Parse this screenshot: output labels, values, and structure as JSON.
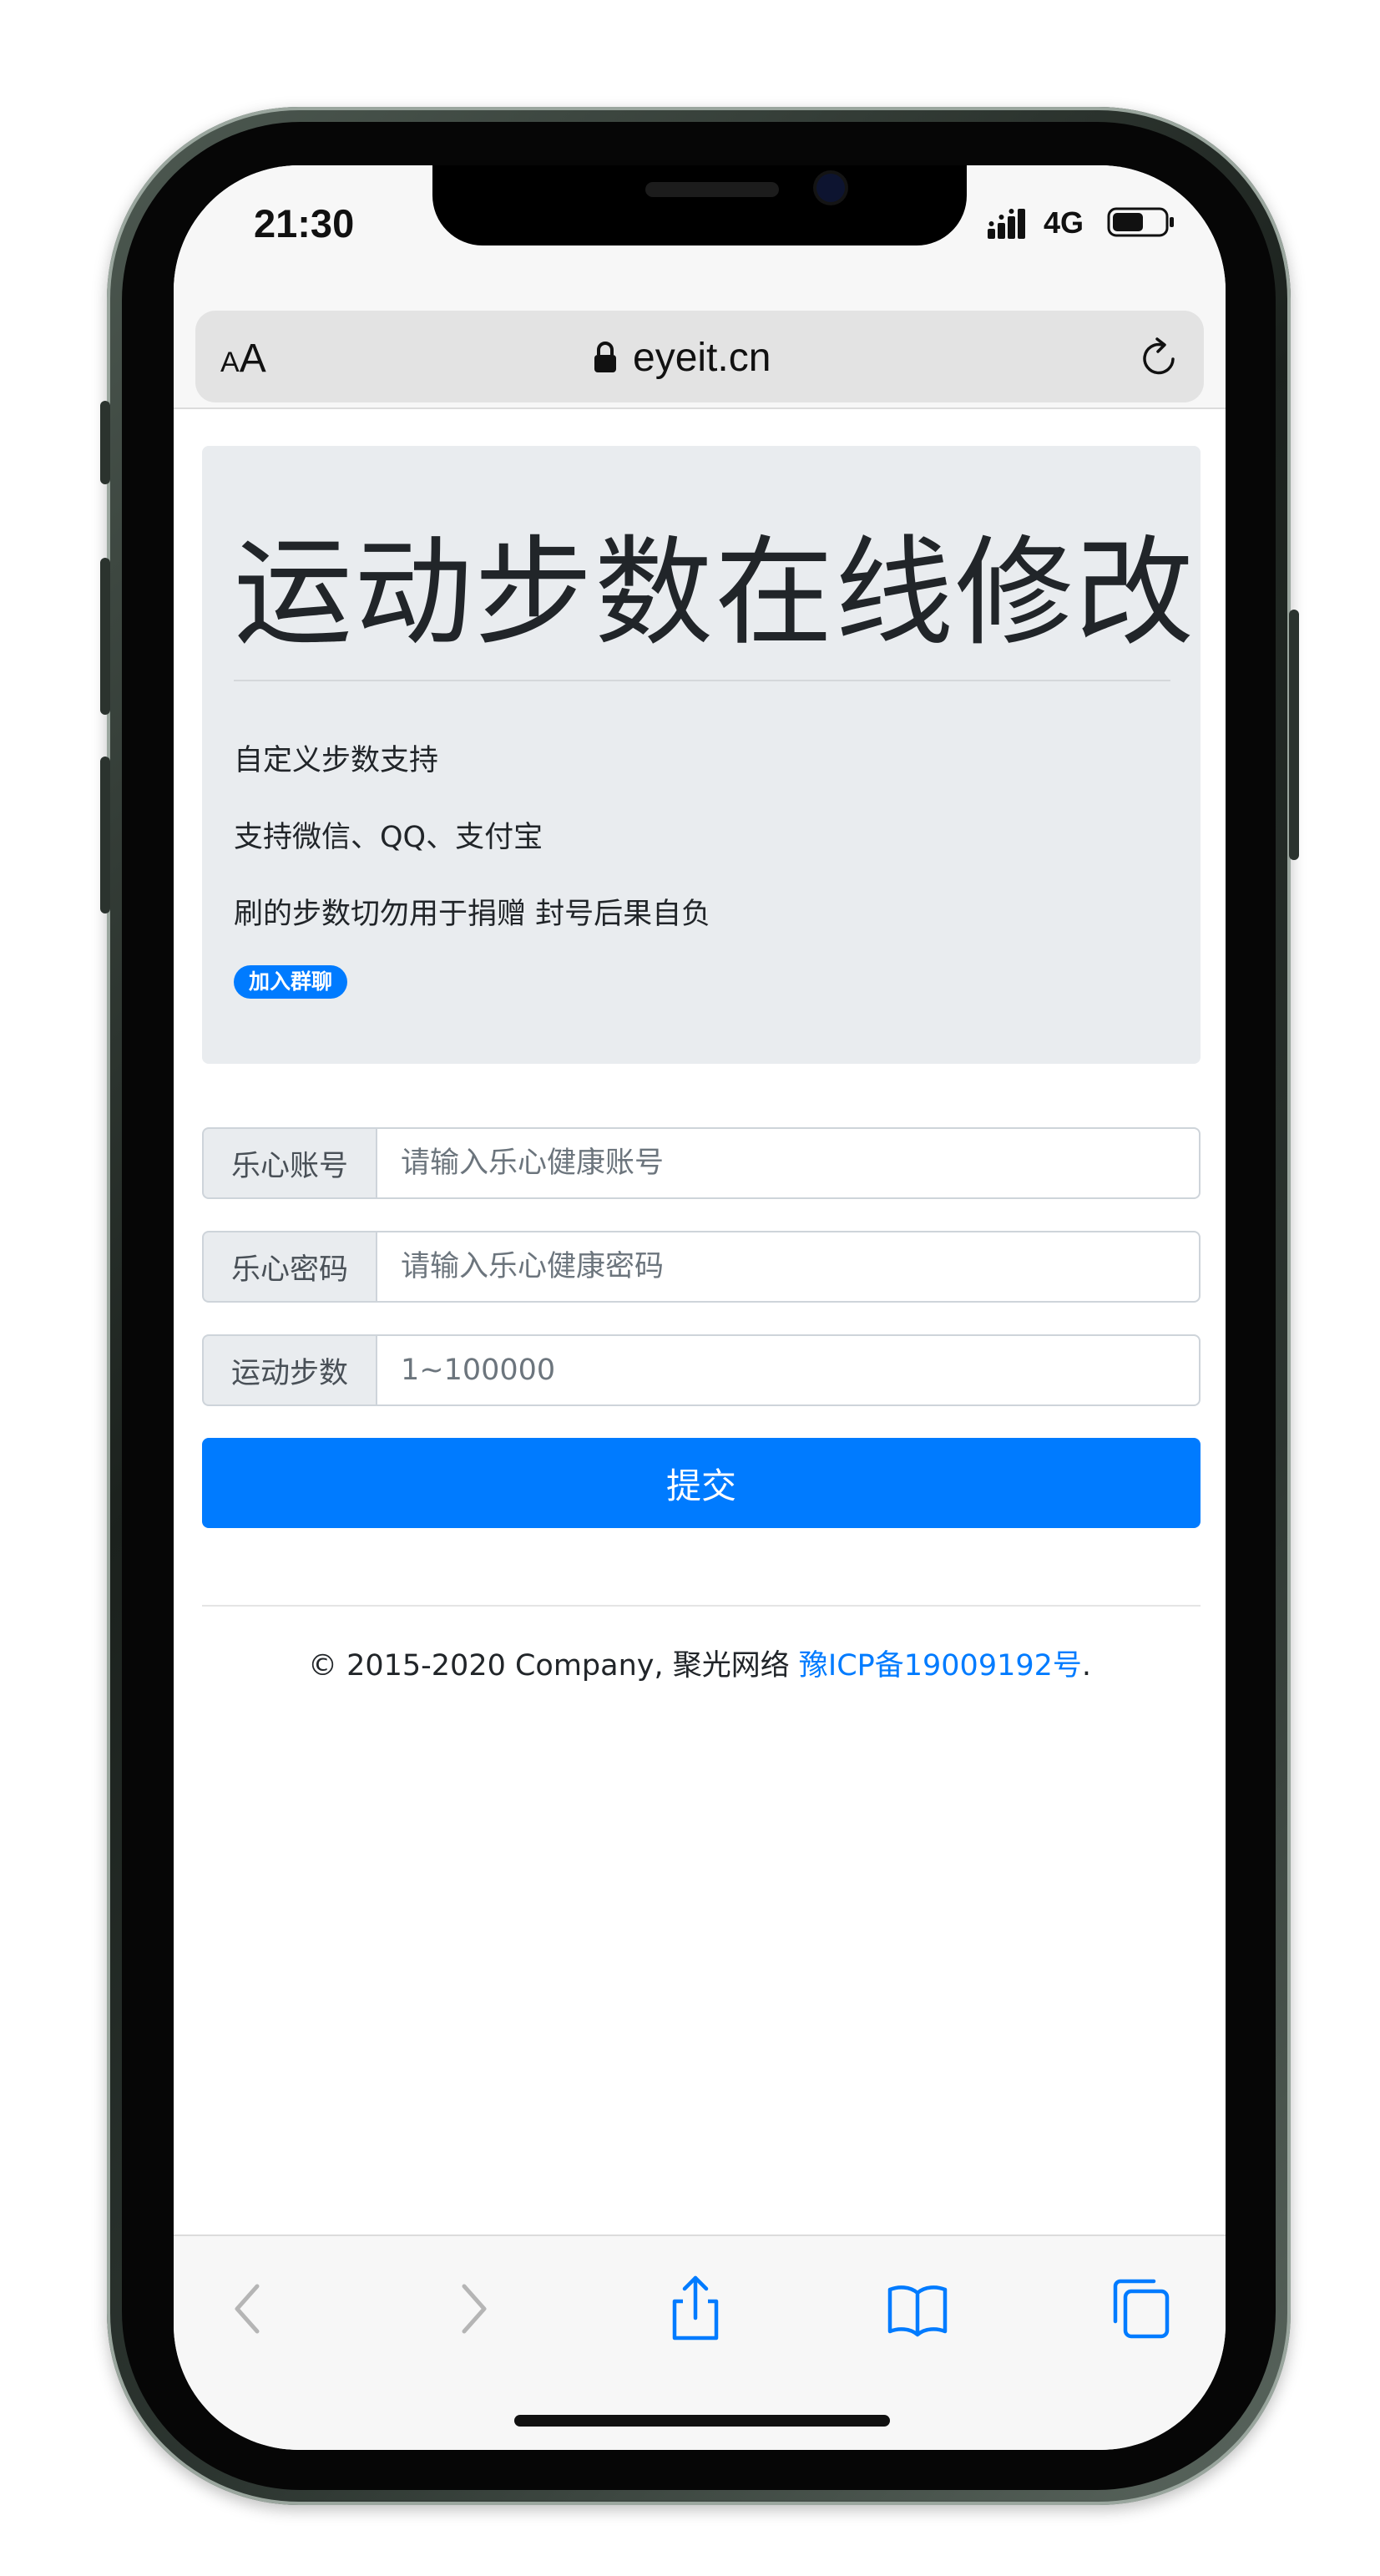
{
  "status_bar": {
    "time": "21:30",
    "network": "4G",
    "icons": [
      "signal-icon",
      "battery-icon"
    ]
  },
  "browser": {
    "text_size_small": "A",
    "text_size_large": "A",
    "url": "eyeit.cn",
    "icons": [
      "lock-icon",
      "reload-icon"
    ]
  },
  "hero": {
    "title": "运动步数在线修改",
    "features": [
      "自定义步数支持",
      "支持微信、QQ、支付宝",
      "刷的步数切勿用于捐赠 封号后果自负"
    ],
    "join_badge": "加入群聊"
  },
  "form": {
    "account": {
      "label": "乐心账号",
      "placeholder": "请输入乐心健康账号",
      "value": ""
    },
    "password": {
      "label": "乐心密码",
      "placeholder": "请输入乐心健康密码",
      "value": ""
    },
    "steps": {
      "label": "运动步数",
      "placeholder": "1~100000",
      "value": ""
    },
    "submit_label": "提交"
  },
  "footer": {
    "copyright": "© 2015-2020 Company, 聚光网络 ",
    "icp_link": "豫ICP备19009192号",
    "period": "."
  },
  "toolbar": {
    "icons": [
      "back-icon",
      "forward-icon",
      "share-icon",
      "bookmarks-icon",
      "tabs-icon"
    ]
  },
  "colors": {
    "accent": "#007bff",
    "jumbotron_bg": "#e9ecef",
    "text": "#212529",
    "disabled_icon": "#b5b5b5"
  }
}
